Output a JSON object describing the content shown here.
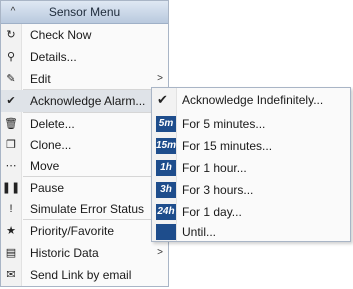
{
  "menu": {
    "title": "Sensor Menu",
    "collapse_icon": "^",
    "items": [
      {
        "label": "Check Now",
        "icon": "refresh-icon",
        "glyph": "↻"
      },
      {
        "label": "Details...",
        "icon": "magnifier-icon",
        "glyph": "⚲"
      },
      {
        "label": "Edit",
        "icon": "pencil-icon",
        "glyph": "✎",
        "submenu": true
      },
      {
        "label": "Acknowledge Alarm...",
        "icon": "checkmark-icon",
        "glyph": "✔",
        "submenu": true,
        "active": true
      },
      {
        "label": "Delete...",
        "icon": "trash-icon",
        "glyph": "🗑"
      },
      {
        "label": "Clone...",
        "icon": "clone-icon",
        "glyph": "❐"
      },
      {
        "label": "Move",
        "icon": "move-icon",
        "glyph": "⋯"
      },
      {
        "label": "Pause",
        "icon": "pause-icon",
        "glyph": "❚❚"
      },
      {
        "label": "Simulate Error Status",
        "icon": "exclamation-icon",
        "glyph": "!"
      },
      {
        "label": "Priority/Favorite",
        "icon": "star-icon",
        "glyph": "★",
        "submenu": true
      },
      {
        "label": "Historic Data",
        "icon": "history-icon",
        "glyph": "▤",
        "submenu": true
      },
      {
        "label": "Send Link by email",
        "icon": "envelope-icon",
        "glyph": "✉"
      }
    ],
    "submenu_arrow": ">"
  },
  "acknowledge_submenu": {
    "check_glyph": "✔",
    "items": [
      {
        "label": "Acknowledge Indefinitely...",
        "badge": ""
      },
      {
        "label": "For 5 minutes...",
        "badge": "5m"
      },
      {
        "label": "For 15 minutes...",
        "badge": "15m"
      },
      {
        "label": "For 1 hour...",
        "badge": "1h"
      },
      {
        "label": "For 3 hours...",
        "badge": "3h"
      },
      {
        "label": "For 1 day...",
        "badge": "24h"
      },
      {
        "label": "Until...",
        "badge": ""
      }
    ]
  },
  "colors": {
    "badge_bg": "#1e4d8c",
    "header_top": "#dfe8f3",
    "header_bottom": "#b9c9de",
    "active_row": "#dfe3e8"
  }
}
